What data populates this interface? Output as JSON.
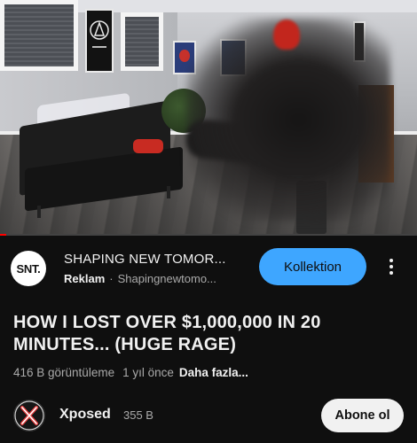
{
  "player": {
    "progress_fraction": 0.015,
    "accent_color": "#ff0000"
  },
  "ad": {
    "logo_text": "SNT.",
    "advertiser_title": "SHAPING NEW TOMOR...",
    "badge": "Reklam",
    "separator": "·",
    "domain": "Shapingnewtomo...",
    "cta_label": "Kollektion",
    "cta_color": "#3ea6ff",
    "menu_icon": "kebab-menu-icon"
  },
  "video": {
    "title": "HOW I LOST OVER $1,000,000 IN 20 MINUTES... (HUGE RAGE)",
    "views": "416 B görüntüleme",
    "age": "1 yıl önce",
    "more_label": "Daha fazla..."
  },
  "channel": {
    "name": "Xposed",
    "subscribers": "355 B",
    "subscribe_label": "Abone ol",
    "avatar_icon": "xposed-logo-icon"
  }
}
